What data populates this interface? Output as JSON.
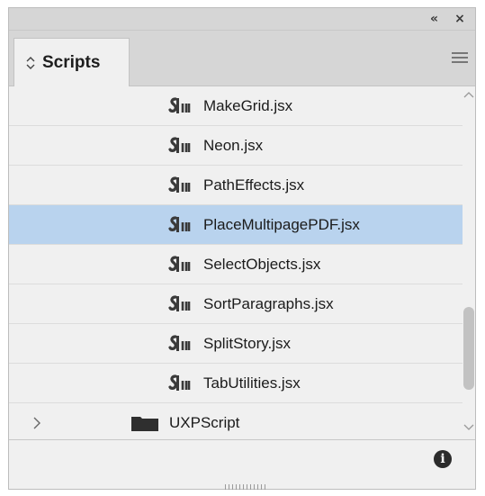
{
  "panel": {
    "tab_label": "Scripts",
    "collapse_glyph": "«",
    "close_glyph": "×",
    "info_glyph": "i"
  },
  "scripts": [
    {
      "name": "MakeGrid.jsx",
      "icon": "script-icon",
      "selected": false
    },
    {
      "name": "Neon.jsx",
      "icon": "script-icon",
      "selected": false
    },
    {
      "name": "PathEffects.jsx",
      "icon": "script-icon",
      "selected": false
    },
    {
      "name": "PlaceMultipagePDF.jsx",
      "icon": "script-icon",
      "selected": true
    },
    {
      "name": "SelectObjects.jsx",
      "icon": "script-icon",
      "selected": false
    },
    {
      "name": "SortParagraphs.jsx",
      "icon": "script-icon",
      "selected": false
    },
    {
      "name": "SplitStory.jsx",
      "icon": "script-icon",
      "selected": false
    },
    {
      "name": "TabUtilities.jsx",
      "icon": "script-icon",
      "selected": false
    }
  ],
  "folder": {
    "name": "UXPScript",
    "icon": "folder-icon",
    "expanded": false
  },
  "colors": {
    "panel_bg": "#f0f0f0",
    "header_bg": "#d6d6d6",
    "selection": "#b9d3ee",
    "scroll_thumb": "#c2c2c2"
  }
}
